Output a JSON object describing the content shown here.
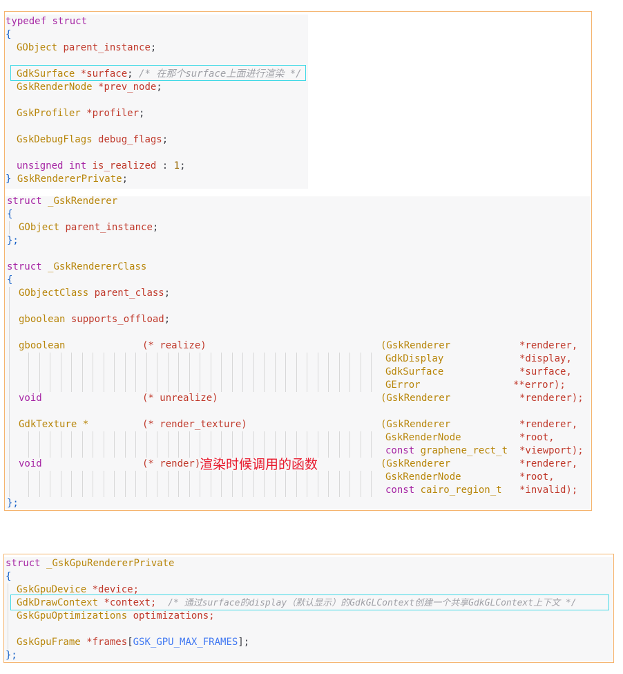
{
  "panel1": {
    "private_typedef": {
      "kw_typedef": "typedef",
      "kw_struct": "struct",
      "open_brace": "{",
      "f1_type": "GObject",
      "f1_name": "parent_instance",
      "f2_type": "GdkSurface",
      "f2_name": "*surface",
      "f2_comment": "/* 在那个surface上面进行渲染 */",
      "f3_type": "GskRenderNode",
      "f3_name": "*prev_node",
      "f4_type": "GskProfiler",
      "f4_name": "*profiler",
      "f5_type": "GskDebugFlags",
      "f5_name": "debug_flags",
      "f6_kw1": "unsigned",
      "f6_kw2": "int",
      "f6_name": "is_realized",
      "f6_colon": ":",
      "f6_bits": "1",
      "close_brace": "}",
      "type_name": "GskRendererPrivate"
    },
    "renderer_struct": {
      "kw_struct": "struct",
      "name": "_GskRenderer",
      "open_brace": "{",
      "f1_type": "GObject",
      "f1_name": "parent_instance",
      "close_brace": "};"
    },
    "renderer_class": {
      "kw_struct": "struct",
      "name": "_GskRendererClass",
      "open_brace": "{",
      "f1_type": "GObjectClass",
      "f1_name": "parent_class",
      "f2_type": "gboolean",
      "f2_name": "supports_offload",
      "close_brace": "};",
      "methods": {
        "realize": {
          "ret": "gboolean",
          "fn": "(* realize)",
          "p1_type": "(GskRenderer",
          "p1_name": "*renderer,",
          "p2_type": "GdkDisplay",
          "p2_name": "*display,",
          "p3_type": "GdkSurface",
          "p3_name": "*surface,",
          "p4_type": "GError",
          "p4_name": "**error);"
        },
        "unrealize": {
          "ret": "void",
          "fn": "(* unrealize)",
          "p1_type": "(GskRenderer",
          "p1_name": "*renderer);"
        },
        "render_texture": {
          "ret": "GdkTexture *",
          "fn": "(* render_texture)",
          "p1_type": "(GskRenderer",
          "p1_name": "*renderer,",
          "p2_type": "GskRenderNode",
          "p2_name": "*root,",
          "p3_kw": "const",
          "p3_type": "graphene_rect_t",
          "p3_name": "*viewport);"
        },
        "render": {
          "ret": "void",
          "fn": "(* render)",
          "annotation": "渲染时候调用的函数",
          "p1_type": "(GskRenderer",
          "p1_name": "*renderer,",
          "p2_type": "GskRenderNode",
          "p2_name": "*root,",
          "p3_kw": "const",
          "p3_type": "cairo_region_t",
          "p3_name": "*invalid);"
        }
      }
    }
  },
  "panel2": {
    "gpu_private": {
      "kw_struct": "struct",
      "name": "_GskGpuRendererPrivate",
      "open_brace": "{",
      "f1_type": "GskGpuDevice",
      "f1_name": "*device;",
      "f2_type": "GdkDrawContext",
      "f2_name": "*context;",
      "f2_comment": "/* 通过surface的display（默认显示）的GdkGLContext创建一个共享GdkGLContext上下文 */",
      "f3_type": "GskGpuOptimizations",
      "f3_name": "optimizations;",
      "f4_type": "GskGpuFrame",
      "f4_name": "*frames",
      "f4_bracket_open": "[",
      "f4_macro": "GSK_GPU_MAX_FRAMES",
      "f4_bracket_close": "];",
      "close_brace": "};"
    }
  }
}
